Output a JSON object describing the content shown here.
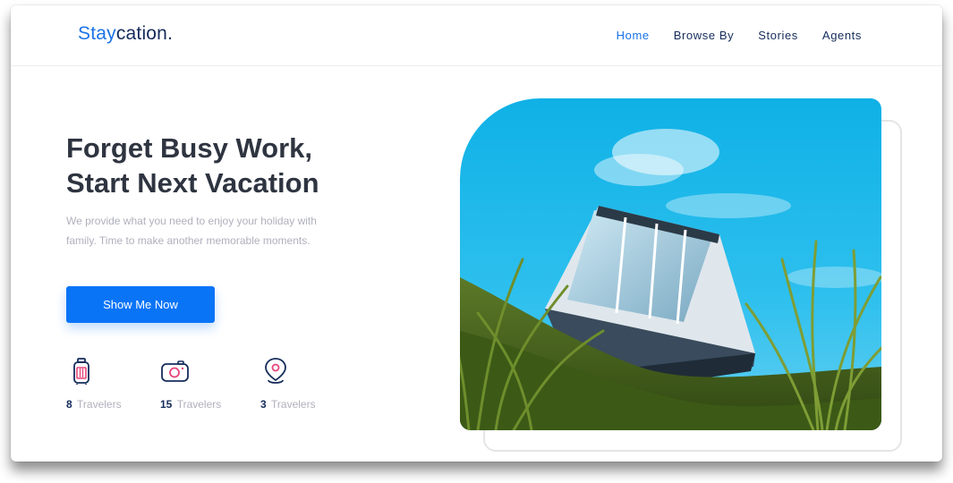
{
  "brand": {
    "accent": "Stay",
    "rest": "cation."
  },
  "nav": {
    "items": [
      "Home",
      "Browse By",
      "Stories",
      "Agents"
    ],
    "active": "Home"
  },
  "hero": {
    "title_line1": "Forget Busy Work,",
    "title_line2": "Start Next Vacation",
    "description": "We provide what you need to enjoy your holiday with family. Time to make another memorable moments.",
    "cta_label": "Show Me Now"
  },
  "stats": [
    {
      "icon": "suitcase-icon",
      "number": "8",
      "label": "Travelers"
    },
    {
      "icon": "camera-icon",
      "number": "15",
      "label": "Travelers"
    },
    {
      "icon": "map-pin-icon",
      "number": "3",
      "label": "Travelers"
    }
  ],
  "colors": {
    "accent": "#1a73e8",
    "button": "#0a74f7",
    "title": "#2e3440",
    "muted": "#b0b0bd",
    "icon_outline": "#152c5b",
    "icon_highlight": "#e5457a"
  },
  "hero_image": {
    "subject": "glass cabin on grassy hill under blue sky"
  }
}
